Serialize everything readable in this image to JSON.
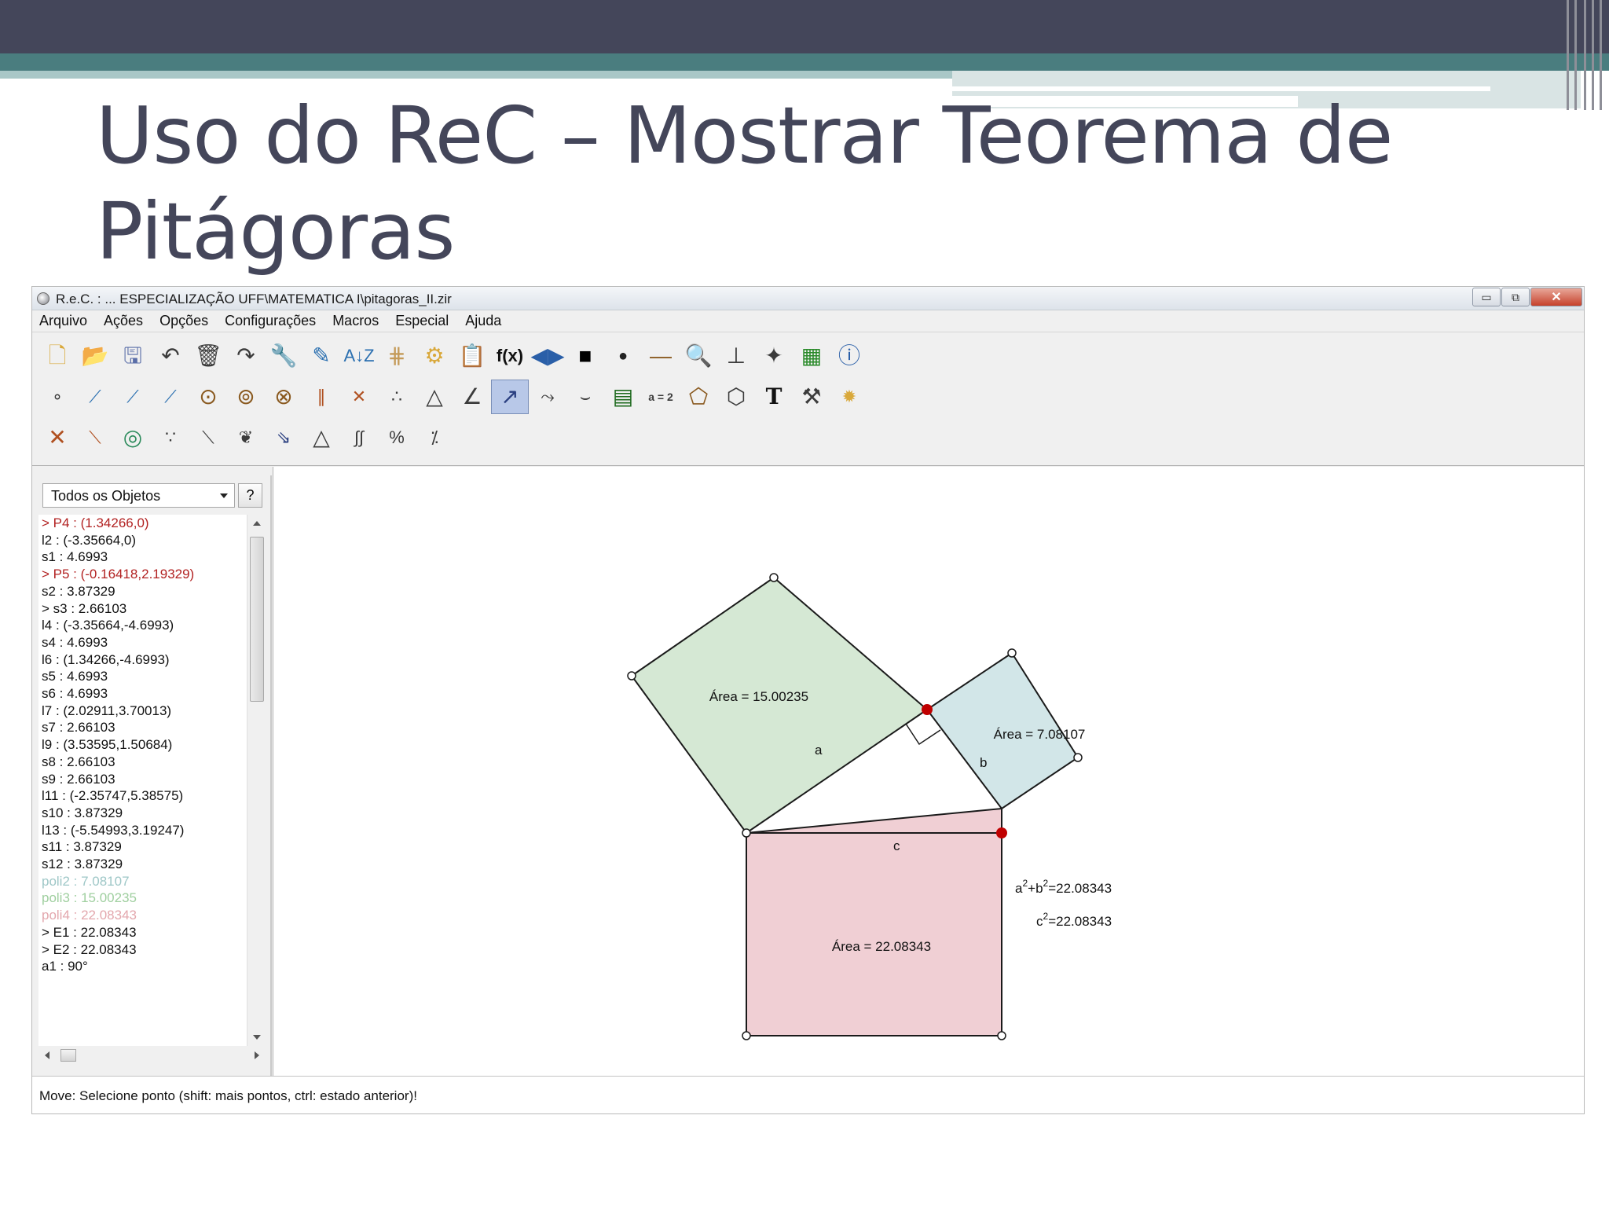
{
  "slide": {
    "title_line1": "Uso do ReC – Mostrar Teorema de",
    "title_line2": "Pitágoras"
  },
  "window": {
    "title": "R.e.C. : ... ESPECIALIZAÇÃO UFF\\MATEMATICA I\\pitagoras_II.zir",
    "buttons": {
      "minimize": "▭",
      "restore": "⧉",
      "close": "✕"
    }
  },
  "menu": [
    "Arquivo",
    "Ações",
    "Opções",
    "Configurações",
    "Macros",
    "Especial",
    "Ajuda"
  ],
  "toolbar": {
    "fx_label": "f(x)",
    "text_tool": "T",
    "formula_tool": "a = 2"
  },
  "side_panel": {
    "filter": "Todos os Objetos",
    "help": "?",
    "objects": [
      {
        "text": "> P4 : (1.34266,0)",
        "color": "#b22222"
      },
      {
        "text": "l2 : (-3.35664,0)",
        "color": "#111111"
      },
      {
        "text": "s1 : 4.6993",
        "color": "#111111"
      },
      {
        "text": "> P5 : (-0.16418,2.19329)",
        "color": "#b22222"
      },
      {
        "text": "s2 : 3.87329",
        "color": "#111111"
      },
      {
        "text": "> s3 : 2.66103",
        "color": "#111111"
      },
      {
        "text": "l4 : (-3.35664,-4.6993)",
        "color": "#111111"
      },
      {
        "text": "s4 : 4.6993",
        "color": "#111111"
      },
      {
        "text": "l6 : (1.34266,-4.6993)",
        "color": "#111111"
      },
      {
        "text": "s5 : 4.6993",
        "color": "#111111"
      },
      {
        "text": "s6 : 4.6993",
        "color": "#111111"
      },
      {
        "text": "l7 : (2.02911,3.70013)",
        "color": "#111111"
      },
      {
        "text": "s7 : 2.66103",
        "color": "#111111"
      },
      {
        "text": "l9 : (3.53595,1.50684)",
        "color": "#111111"
      },
      {
        "text": "s8 : 2.66103",
        "color": "#111111"
      },
      {
        "text": "s9 : 2.66103",
        "color": "#111111"
      },
      {
        "text": "l11 : (-2.35747,5.38575)",
        "color": "#111111"
      },
      {
        "text": "s10 : 3.87329",
        "color": "#111111"
      },
      {
        "text": "l13 : (-5.54993,3.19247)",
        "color": "#111111"
      },
      {
        "text": "s11 : 3.87329",
        "color": "#111111"
      },
      {
        "text": "s12 : 3.87329",
        "color": "#111111"
      },
      {
        "text": "poli2 : 7.08107",
        "color": "#9ec7c7"
      },
      {
        "text": "poli3 : 15.00235",
        "color": "#9fcf9f"
      },
      {
        "text": "poli4 : 22.08343",
        "color": "#e3a7ad"
      },
      {
        "text": "> E1 : 22.08343",
        "color": "#111111"
      },
      {
        "text": "> E2 : 22.08343",
        "color": "#111111"
      },
      {
        "text": "a1 : 90°",
        "color": "#111111"
      }
    ]
  },
  "canvas": {
    "green_area": "Área = 15.00235",
    "blue_area": "Área = 7.08107",
    "pink_area": "Área = 22.08343",
    "label_a": "a",
    "label_b": "b",
    "label_c": "c",
    "sum_expr": "=22.08343",
    "c2_expr": "=22.08343",
    "colors": {
      "green_fill": "#d5e8d4",
      "blue_fill": "#d2e6e8",
      "pink_fill": "#f0cfd4",
      "point_red": "#c00000"
    }
  },
  "status": "Move: Selecione ponto (shift: mais pontos, ctrl: estado anterior)!"
}
